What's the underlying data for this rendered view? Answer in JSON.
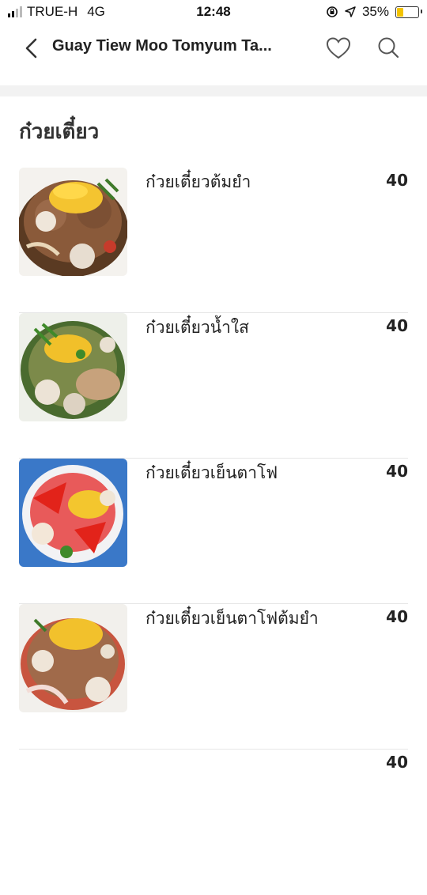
{
  "status_bar": {
    "carrier": "TRUE-H",
    "network": "4G",
    "time": "12:48",
    "battery": "35%",
    "battery_level": 0.35
  },
  "header": {
    "title": "Guay Tiew Moo Tomyum Ta..."
  },
  "section": {
    "title": "ก๋วยเตี๋ยว"
  },
  "items": [
    {
      "name": "ก๋วยเตี๋ยวต้มยำ",
      "price": "40"
    },
    {
      "name": "ก๋วยเตี๋ยวน้ำใส",
      "price": "40"
    },
    {
      "name": "ก๋วยเตี๋ยวเย็นตาโฟ",
      "price": "40"
    },
    {
      "name": "ก๋วยเตี๋ยวเย็นตาโฟต้มยำ",
      "price": "40"
    },
    {
      "name": "",
      "price": "40"
    }
  ],
  "icons": [
    "back-icon",
    "heart-icon",
    "search-icon",
    "location-icon",
    "lock-rotation-icon"
  ],
  "colors": {
    "battery": "#f3c300",
    "accent": "#222222"
  }
}
